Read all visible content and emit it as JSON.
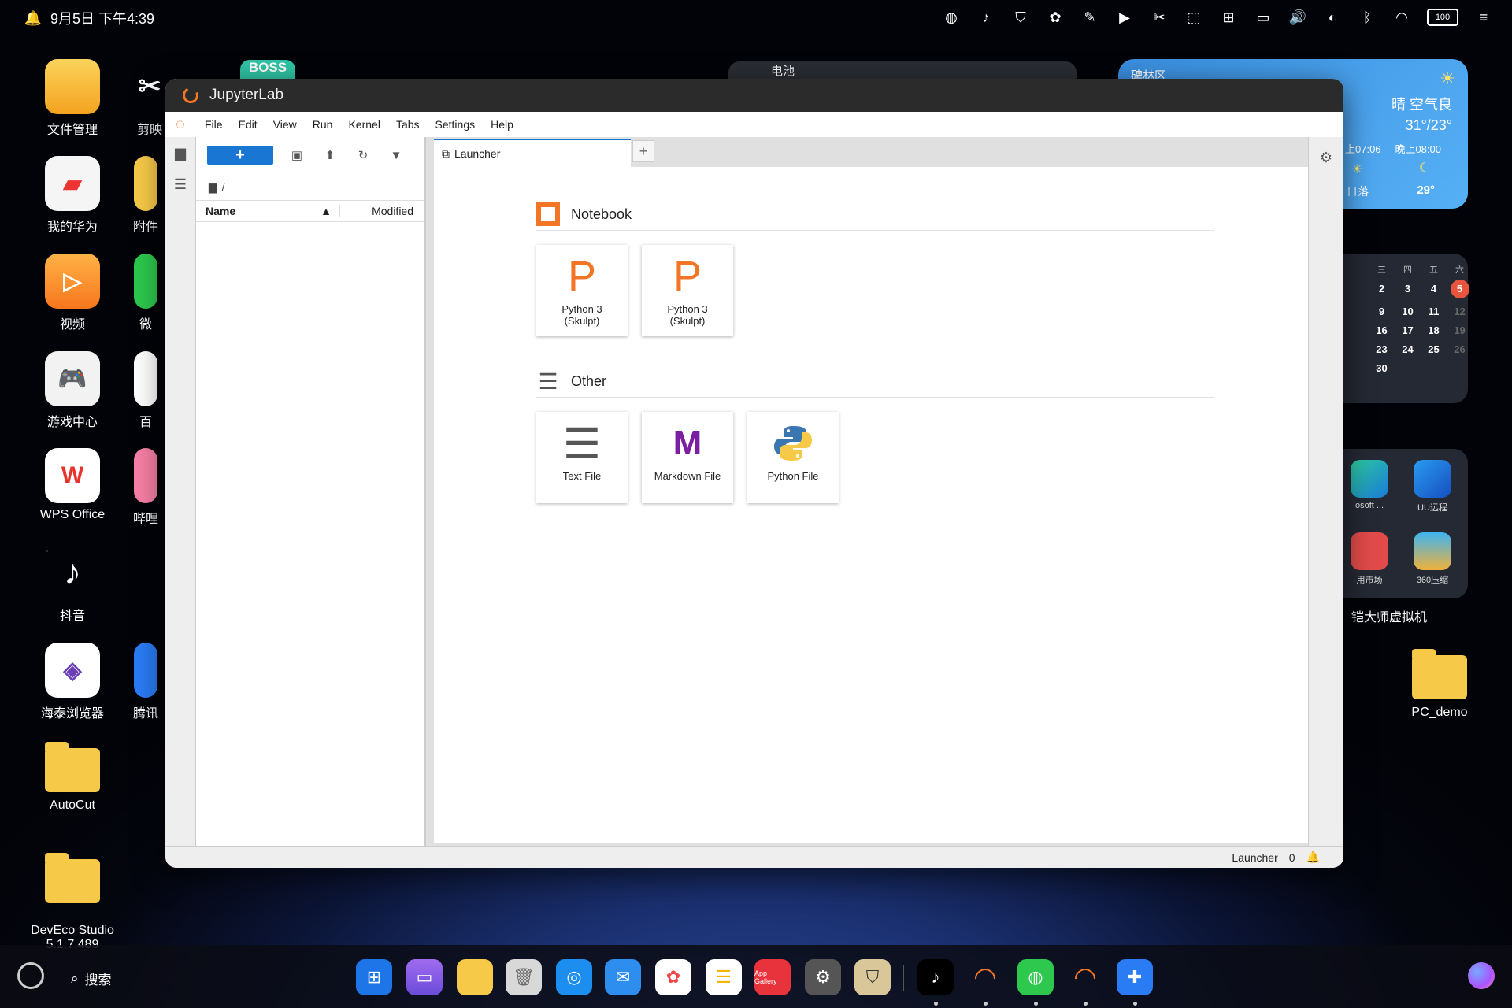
{
  "status_bar": {
    "datetime": "9月5日 下午4:39",
    "battery": "100"
  },
  "desktop_left": [
    {
      "label": "文件管理",
      "icon": "folder-icon"
    },
    {
      "label": "我的华为",
      "icon": "huawei-icon"
    },
    {
      "label": "视频",
      "icon": "video-icon"
    },
    {
      "label": "游戏中心",
      "icon": "gamepad-icon"
    },
    {
      "label": "WPS Office",
      "icon": "wps-icon"
    },
    {
      "label": "抖音",
      "icon": "douyin-icon"
    },
    {
      "label": "海泰浏览器",
      "icon": "browser-icon"
    },
    {
      "label": "AutoCut",
      "icon": "folder-icon"
    },
    {
      "label": "DevEco Studio\n5.1.7.489",
      "icon": "folder-icon"
    }
  ],
  "desktop_left2": [
    "剪映",
    "附件",
    "微",
    "百",
    "哔哩",
    "腾讯"
  ],
  "widgets": {
    "top_widget": "电池",
    "boss": "BOSS",
    "weather": {
      "location": "碑林区",
      "cond": "晴  空气良",
      "temp": "31°/23°",
      "sunrise": "上07:06",
      "sunset": "晚上08:00",
      "sunset_label": "日落",
      "night_temp": "29°"
    },
    "calendar": {
      "headers": [
        "三",
        "四",
        "五",
        "六"
      ],
      "rows": [
        [
          "2",
          "3",
          "4",
          "5"
        ],
        [
          "9",
          "10",
          "11",
          "12"
        ],
        [
          "16",
          "17",
          "18",
          "19"
        ],
        [
          "23",
          "24",
          "25",
          "26"
        ],
        [
          "30",
          "",
          "",
          ""
        ]
      ]
    },
    "apps": [
      {
        "label": "osoft ..."
      },
      {
        "label": "UU远程"
      },
      {
        "label": "用市场"
      },
      {
        "label": "360压缩"
      }
    ],
    "apps_title": "铠大师虚拟机",
    "pc_demo": "PC_demo"
  },
  "window": {
    "title": "JupyterLab",
    "menu": [
      "File",
      "Edit",
      "View",
      "Run",
      "Kernel",
      "Tabs",
      "Settings",
      "Help"
    ],
    "file_browser": {
      "path": "/",
      "col_name": "Name",
      "col_modified": "Modified",
      "new_label": "+"
    },
    "tab": {
      "label": "Launcher"
    },
    "sections": {
      "notebook": {
        "title": "Notebook",
        "cards": [
          {
            "glyph": "P",
            "label": "Python 3\n(Skulpt)"
          },
          {
            "glyph": "P",
            "label": "Python 3\n(Skulpt)"
          }
        ]
      },
      "other": {
        "title": "Other",
        "cards": [
          {
            "label": "Text File"
          },
          {
            "glyph": "M",
            "label": "Markdown File"
          },
          {
            "label": "Python File"
          }
        ]
      }
    },
    "status": {
      "label": "Launcher",
      "count": "0"
    }
  },
  "dock": {
    "search": "搜索",
    "app_gallery": "App Gallery"
  }
}
